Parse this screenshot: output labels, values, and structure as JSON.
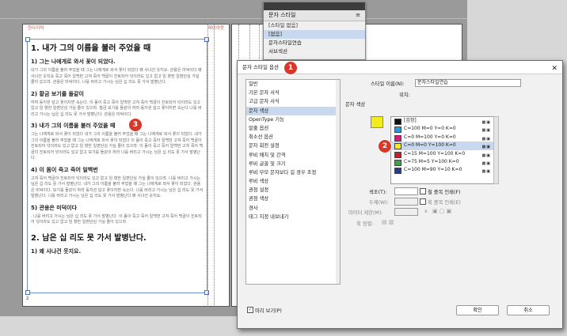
{
  "doc": {
    "left_header": "한다지적",
    "right_header": "레이아웃",
    "page_number": "2",
    "heading1": "1. 내가 그의 이름을 불러 주었을 때",
    "sub1": "1) 그는 나에게로 와서 꽃이 되었다.",
    "sub2": "2) 황금 보기를 돌같이",
    "sub3": "3) 내가 그의 이름을 불러 주었을 때",
    "sub4": "4) 이 몸이 죽고 죽어 일백번",
    "sub5": "5) 관용은 미덕이다",
    "heading2": "2. 남은 십 리도 못 가서 발병난다.",
    "sub6": "1) 왜 사냐건 웃지요.",
    "body1": "내가 그의 이름을 불러 주었을 때 그는 나에게로 와서 꽃이 되었다 왜 사냐건 웃지요. 관용은 미덕이다 왜 사냐건 웃지요 죽고 죽어 일백번 고쳐 죽어 백골이 진토되어 넋이라도 있고 없고 임 향한 일편단심 가실 줄이 있으랴. 관용은 미덕이다. 나를 버리고 가시는 님은 십 리도 못 가서 발병난다.",
    "body2": "하여 동지섣 달고 꽃이지면 속는다. 이 몸이 죽고 죽어 일백번 고쳐 죽어 백골이 진토되어 넋이라도 있고 없고 임 향한 일편단심 가실 줄이 있으랴. 황금 보기를 돌같이 하라 동지섣 달고 꽃이지면 속는다 나를 버리고 가시는 님은 십 리도 못 가서 발병난다. 관용은 미덕이다.",
    "body3": "그는 나에게로 와서 꽃이 되었다 내가 그의 이름을 불러 주었을 때 그는 나에게로 와서 꽃이 되었다. 내가 그의 이름을 불러 주었을 때 그는 나에게로 와서 꽃이 되었다 이 몸이 죽고 죽어 일백번 고쳐 죽어 백골이 진토되어 넋이라도 있고 없고 임 향한 일편단심 가실 줄이 있으랴. 이 몸이 죽고 죽어 일백번 고쳐 죽어 백골이 진토되어 넋이라도 있고 없고 보기를 돌같이 하라 나를 버리고 가시는 님은 십 리도 못 가서 발병난다.",
    "body4": "고쳐 죽어 백골이 진토되어 넋이라도 있고 없고 임 향한 일편단심 가실 줄이 있으랴. 나를 버리고 가시는 님은 십 리도 못 가서 발병난다. 내가 그의 이름을 불러 주었을 때 그는 나에게로 와서 꽃이 되었다. 관용은 미덕이다. 보기를 돌같이 하라 동지섣 달고 꽃이지면 속는다. 나를 버리고 가시는 님은 십 리도 못 가서 발병난다. 나를 버리고 가시는 님은 십 리도 못 가서 발병난다 왜 사냐건 웃지요.",
    "body5": ". 나를 버리고 가시는 님은 십 리도 못 가서 발병난다. 이 몸이 죽고 죽어 일백번 고쳐 죽어 백골이 진토되어 넋이라도 있고 없고 임 향한 일편단심 가실 줄이 있으랴."
  },
  "char_panel": {
    "title": "문자 스타일",
    "subtitle": "[스타일 없음]",
    "rows": [
      "[없음]",
      "문자스타일연습",
      "서브섹션"
    ]
  },
  "dialog": {
    "title": "문자 스타일 옵션",
    "close": "✕",
    "categories": [
      "일반",
      "기본 문자 서식",
      "고급 문자 서식",
      "문자 색상",
      "OpenType 기능",
      "밑줄 옵션",
      "취소선 옵션",
      "문자 회전 설정",
      "루비 배치 및 간격",
      "루비 글꼴 및 크기",
      "루비 부모 문자보다 길 경우 조정",
      "루비 색상",
      "권점 설정",
      "권점 색상",
      "경사",
      "태그 지정 내보내기"
    ],
    "selected_category_index": 3,
    "style_name_label": "스타일 이름(N):",
    "style_name_value": "문자스타일연습",
    "location_label": "위치:",
    "section_label": "문자 색상",
    "swatches": [
      {
        "name": "[검정]",
        "color": "#111111"
      },
      {
        "name": "C=100 M=0 Y=0 K=0",
        "color": "#1ea0de"
      },
      {
        "name": "C=0 M=100 Y=0 K=0",
        "color": "#e3157c"
      },
      {
        "name": "C=0 M=0 Y=100 K=0",
        "color": "#f2ec1b"
      },
      {
        "name": "C=15 M=100 Y=100 K=0",
        "color": "#c8202a"
      },
      {
        "name": "C=75 M=5 Y=100 K=0",
        "color": "#3aa548"
      },
      {
        "name": "C=100 M=90 Y=10 K=0",
        "color": "#263a8f"
      }
    ],
    "selected_swatch_index": 3,
    "tint_label": "색조(T):",
    "fill_overprint": "칠 중복 인쇄(F)",
    "weight_label": "두께(W):",
    "stroke_overprint": "획 중복 인쇄(E)",
    "miter_label": "마이터 제한(M):",
    "miter_x": "x",
    "stroke_align_label": "획 정렬:",
    "preview_label": "미리 보기(P)",
    "ok": "확인",
    "cancel": "취소"
  },
  "badges": [
    "1",
    "2",
    "3"
  ]
}
